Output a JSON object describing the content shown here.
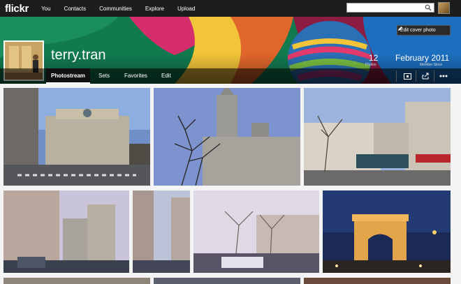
{
  "nav": {
    "logo": "flickr",
    "items": [
      "You",
      "Contacts",
      "Communities",
      "Explore",
      "Upload"
    ],
    "search_placeholder": ""
  },
  "cover": {
    "edit_label": "Edit cover photo",
    "username": "terry.tran",
    "stats": [
      {
        "value": "12",
        "label": "Photos"
      },
      {
        "value": "February 2011",
        "label": "Member Since"
      }
    ]
  },
  "tabs": [
    "Photostream",
    "Sets",
    "Favorites",
    "Edit"
  ],
  "tools": [
    "slideshow-icon",
    "share-icon",
    "more-icon"
  ],
  "photos": [
    {
      "name": "photo-opera-garnier"
    },
    {
      "name": "photo-church-tree"
    },
    {
      "name": "photo-street-market"
    },
    {
      "name": "photo-street-left"
    },
    {
      "name": "photo-street-mid"
    },
    {
      "name": "photo-street-right"
    },
    {
      "name": "photo-trees-street"
    },
    {
      "name": "photo-arc-de-triomphe"
    }
  ]
}
